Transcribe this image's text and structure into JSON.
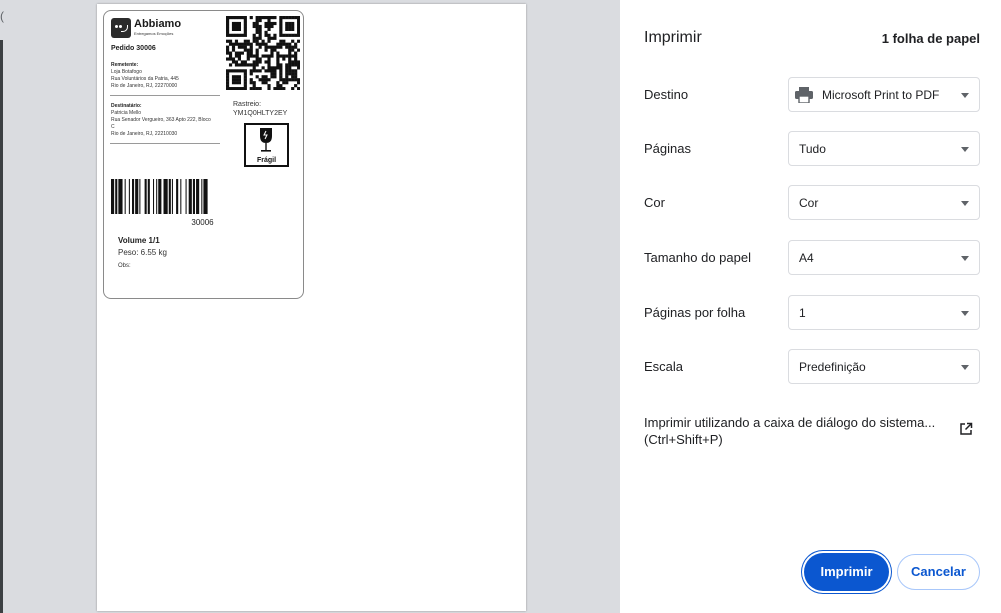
{
  "preview": {
    "label": {
      "brand_name": "Abbiamo",
      "brand_tagline": "Entregamos Emoções",
      "order": "Pedido 30006",
      "sender": {
        "heading": "Remetente:",
        "name": "Loja Botafogo",
        "street": "Rua Voluntários da Patria, 445",
        "city": "Rio de Janeiro, RJ, 22270000"
      },
      "recipient": {
        "heading": "Destinatário:",
        "name": "Patricia Mello",
        "street": "Rua Senador Vergueiro, 363 Apto 222, Bloco",
        "street_cont": "C",
        "city": "Rio de Janeiro, RJ, 22210030"
      },
      "tracking_label": "Rastreio:",
      "tracking_code": "YM1Q0HLTY2EY",
      "fragile_label": "Frágil",
      "barcode_number": "30006",
      "volume": "Volume 1/1",
      "weight": "Peso: 6.55 kg",
      "notes": "Obs:"
    }
  },
  "panel": {
    "title": "Imprimir",
    "sheet_count": "1 folha de papel",
    "rows": [
      {
        "label": "Destino",
        "value": "Microsoft Print to PDF",
        "icon": "printer-icon"
      },
      {
        "label": "Páginas",
        "value": "Tudo"
      },
      {
        "label": "Cor",
        "value": "Cor"
      },
      {
        "label": "Tamanho do papel",
        "value": "A4"
      },
      {
        "label": "Páginas por folha",
        "value": "1"
      },
      {
        "label": "Escala",
        "value": "Predefinição"
      }
    ],
    "system_dialog_line1": "Imprimir utilizando a caixa de diálogo do sistema...",
    "system_dialog_line2": "(Ctrl+Shift+P)",
    "print_label": "Imprimir",
    "cancel_label": "Cancelar"
  },
  "colors": {
    "accent": "#0b57d0",
    "preview_background": "#dadce0"
  }
}
